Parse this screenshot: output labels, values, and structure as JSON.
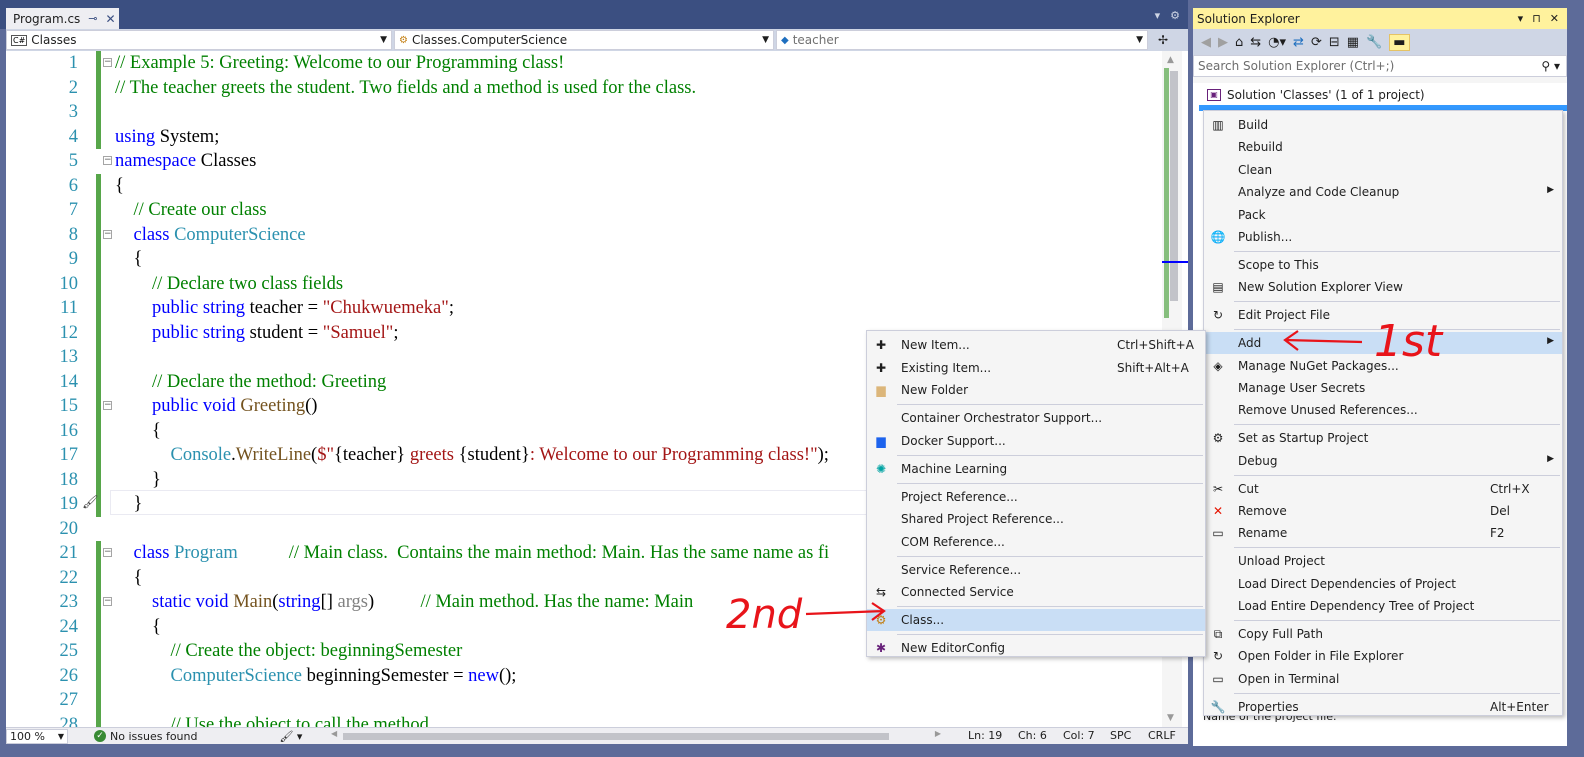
{
  "editor": {
    "tab": {
      "title": "Program.cs",
      "pin_glyph": "⊸",
      "close_glyph": "✕"
    },
    "tabstrip_controls": [
      "▾",
      "⚙"
    ],
    "nav": {
      "project": "Classes",
      "project_icon": "C#",
      "type": "Classes.ComputerScience",
      "member": "teacher",
      "split_glyph": "✢"
    },
    "lines": [
      {
        "n": "1",
        "fold": "⊟",
        "html": "<span class=\"cm\">// Example 5: Greeting: Welcome to our Programming class!</span>"
      },
      {
        "n": "2",
        "fold": "",
        "html": "<span class=\"cm\">// The teacher greets the student. Two fields and a method is used for the class.</span>"
      },
      {
        "n": "3",
        "fold": "",
        "html": ""
      },
      {
        "n": "4",
        "fold": "",
        "html": "<span class=\"kw\">using</span> System;"
      },
      {
        "n": "5",
        "fold": "⊟",
        "html": "<span class=\"kw\">namespace</span> Classes"
      },
      {
        "n": "6",
        "fold": "",
        "html": "{"
      },
      {
        "n": "7",
        "fold": "",
        "html": "    <span class=\"cm\">// Create our class</span>"
      },
      {
        "n": "8",
        "fold": "⊟",
        "html": "    <span class=\"kw\">class</span> <span class=\"ty\">ComputerScience</span>"
      },
      {
        "n": "9",
        "fold": "",
        "html": "    {"
      },
      {
        "n": "10",
        "fold": "",
        "html": "        <span class=\"cm\">// Declare two class fields</span>"
      },
      {
        "n": "11",
        "fold": "",
        "html": "        <span class=\"kw\">public</span> <span class=\"kw\">string</span> teacher = <span class=\"st\">\"Chukwuemeka\"</span>;"
      },
      {
        "n": "12",
        "fold": "",
        "html": "        <span class=\"kw\">public</span> <span class=\"kw\">string</span> student = <span class=\"st\">\"Samuel\"</span>;"
      },
      {
        "n": "13",
        "fold": "",
        "html": ""
      },
      {
        "n": "14",
        "fold": "",
        "html": "        <span class=\"cm\">// Declare the method: Greeting</span>"
      },
      {
        "n": "15",
        "fold": "⊟",
        "html": "        <span class=\"kw\">public</span> <span class=\"kw\">void</span> <span class=\"mt\">Greeting</span>()"
      },
      {
        "n": "16",
        "fold": "",
        "html": "        {"
      },
      {
        "n": "17",
        "fold": "",
        "html": "            <span class=\"ty\">Console</span>.<span class=\"mt\">WriteLine</span>(<span class=\"st\">$\"</span>{teacher}<span class=\"st\"> greets </span>{student}<span class=\"st\">: Welcome to our Programming class!\"</span>);"
      },
      {
        "n": "18",
        "fold": "",
        "html": "        }"
      },
      {
        "n": "19",
        "fold": "",
        "html": "    }"
      },
      {
        "n": "20",
        "fold": "",
        "html": ""
      },
      {
        "n": "21",
        "fold": "⊟",
        "html": "    <span class=\"kw\">class</span> <span class=\"ty\">Program</span>           <span class=\"cm\">// Main class.  Contains the main method: Main. Has the same name as fi</span>"
      },
      {
        "n": "22",
        "fold": "",
        "html": "    {"
      },
      {
        "n": "23",
        "fold": "⊟",
        "html": "        <span class=\"kw\">static</span> <span class=\"kw\">void</span> <span class=\"mt\">Main</span>(<span class=\"kw\">string</span>[] <span class=\"pm\">args</span>)          <span class=\"cm\">// Main method. Has the name: Main</span>"
      },
      {
        "n": "24",
        "fold": "",
        "html": "        {"
      },
      {
        "n": "25",
        "fold": "",
        "html": "            <span class=\"cm\">// Create the object: beginningSemester</span>"
      },
      {
        "n": "26",
        "fold": "",
        "html": "            <span class=\"ty\">ComputerScience</span> beginningSemester = <span class=\"kw\">new</span>();"
      },
      {
        "n": "27",
        "fold": "",
        "html": ""
      },
      {
        "n": "28",
        "fold": "",
        "html": "            <span class=\"cm\">// Use the object to call the method</span>"
      }
    ],
    "status": {
      "zoom": "100 %",
      "issues": "No issues found",
      "ln": "Ln: 19",
      "ch": "Ch: 6",
      "col": "Col: 7",
      "spc": "SPC",
      "crlf": "CRLF"
    }
  },
  "solution_explorer": {
    "title": "Solution Explorer",
    "title_controls": [
      "▾",
      "⊓",
      "✕"
    ],
    "search_placeholder": "Search Solution Explorer (Ctrl+;)",
    "solution_label": "Solution 'Classes' (1 of 1 project)",
    "properties_fragment": "Name of the project file."
  },
  "context_menu": [
    {
      "icon": "▥",
      "label": "Build",
      "shortcut": "",
      "arrow": false
    },
    {
      "icon": "",
      "label": "Rebuild",
      "shortcut": "",
      "arrow": false
    },
    {
      "icon": "",
      "label": "Clean",
      "shortcut": "",
      "arrow": false
    },
    {
      "icon": "",
      "label": "Analyze and Code Cleanup",
      "shortcut": "",
      "arrow": true
    },
    {
      "icon": "",
      "label": "Pack",
      "shortcut": "",
      "arrow": false
    },
    {
      "icon": "🌐",
      "label": "Publish...",
      "shortcut": "",
      "arrow": false
    },
    {
      "sep": true
    },
    {
      "icon": "",
      "label": "Scope to This",
      "shortcut": "",
      "arrow": false
    },
    {
      "icon": "▤",
      "label": "New Solution Explorer View",
      "shortcut": "",
      "arrow": false
    },
    {
      "sep": true
    },
    {
      "icon": "↻",
      "label": "Edit Project File",
      "shortcut": "",
      "arrow": false
    },
    {
      "sep": true
    },
    {
      "icon": "",
      "label": "Add",
      "shortcut": "",
      "arrow": true,
      "highlight": true
    },
    {
      "icon": "◈",
      "label": "Manage NuGet Packages...",
      "shortcut": "",
      "arrow": false
    },
    {
      "icon": "",
      "label": "Manage User Secrets",
      "shortcut": "",
      "arrow": false
    },
    {
      "icon": "",
      "label": "Remove Unused References...",
      "shortcut": "",
      "arrow": false
    },
    {
      "sep": true
    },
    {
      "icon": "⚙",
      "label": "Set as Startup Project",
      "shortcut": "",
      "arrow": false
    },
    {
      "icon": "",
      "label": "Debug",
      "shortcut": "",
      "arrow": true
    },
    {
      "sep": true
    },
    {
      "icon": "✂",
      "label": "Cut",
      "shortcut": "Ctrl+X",
      "arrow": false
    },
    {
      "icon": "✕",
      "label": "Remove",
      "shortcut": "Del",
      "arrow": false,
      "icon_color": "#e51400"
    },
    {
      "icon": "▭",
      "label": "Rename",
      "shortcut": "F2",
      "arrow": false
    },
    {
      "sep": true
    },
    {
      "icon": "",
      "label": "Unload Project",
      "shortcut": "",
      "arrow": false
    },
    {
      "icon": "",
      "label": "Load Direct Dependencies of Project",
      "shortcut": "",
      "arrow": false
    },
    {
      "icon": "",
      "label": "Load Entire Dependency Tree of Project",
      "shortcut": "",
      "arrow": false
    },
    {
      "sep": true
    },
    {
      "icon": "⧉",
      "label": "Copy Full Path",
      "shortcut": "",
      "arrow": false
    },
    {
      "icon": "↻",
      "label": "Open Folder in File Explorer",
      "shortcut": "",
      "arrow": false
    },
    {
      "icon": "▭",
      "label": "Open in Terminal",
      "shortcut": "",
      "arrow": false
    },
    {
      "sep": true
    },
    {
      "icon": "🔧",
      "label": "Properties",
      "shortcut": "Alt+Enter",
      "arrow": false
    }
  ],
  "add_submenu": [
    {
      "icon": "✚",
      "label": "New Item...",
      "shortcut": "Ctrl+Shift+A"
    },
    {
      "icon": "✚",
      "label": "Existing Item...",
      "shortcut": "Shift+Alt+A"
    },
    {
      "icon": "▆",
      "label": "New Folder",
      "shortcut": "",
      "icon_color": "#dcb67a"
    },
    {
      "sep": true
    },
    {
      "icon": "",
      "label": "Container Orchestrator Support...",
      "shortcut": ""
    },
    {
      "icon": "▆",
      "label": "Docker Support...",
      "shortcut": "",
      "icon_color": "#1d63ed"
    },
    {
      "sep": true
    },
    {
      "icon": "✺",
      "label": "Machine Learning",
      "shortcut": "",
      "icon_color": "#00a3a3"
    },
    {
      "sep": true
    },
    {
      "icon": "",
      "label": "Project Reference...",
      "shortcut": ""
    },
    {
      "icon": "",
      "label": "Shared Project Reference...",
      "shortcut": ""
    },
    {
      "icon": "",
      "label": "COM Reference...",
      "shortcut": ""
    },
    {
      "sep": true
    },
    {
      "icon": "",
      "label": "Service Reference...",
      "shortcut": ""
    },
    {
      "icon": "⇆",
      "label": "Connected Service",
      "shortcut": ""
    },
    {
      "sep": true
    },
    {
      "icon": "⚙",
      "label": "Class...",
      "shortcut": "",
      "highlight": true,
      "icon_color": "#c27d0e"
    },
    {
      "sep": true
    },
    {
      "icon": "✱",
      "label": "New EditorConfig",
      "shortcut": "",
      "icon_color": "#68217a"
    }
  ],
  "annotations": {
    "first": "1st",
    "second": "2nd",
    "color": "#e8141a"
  }
}
